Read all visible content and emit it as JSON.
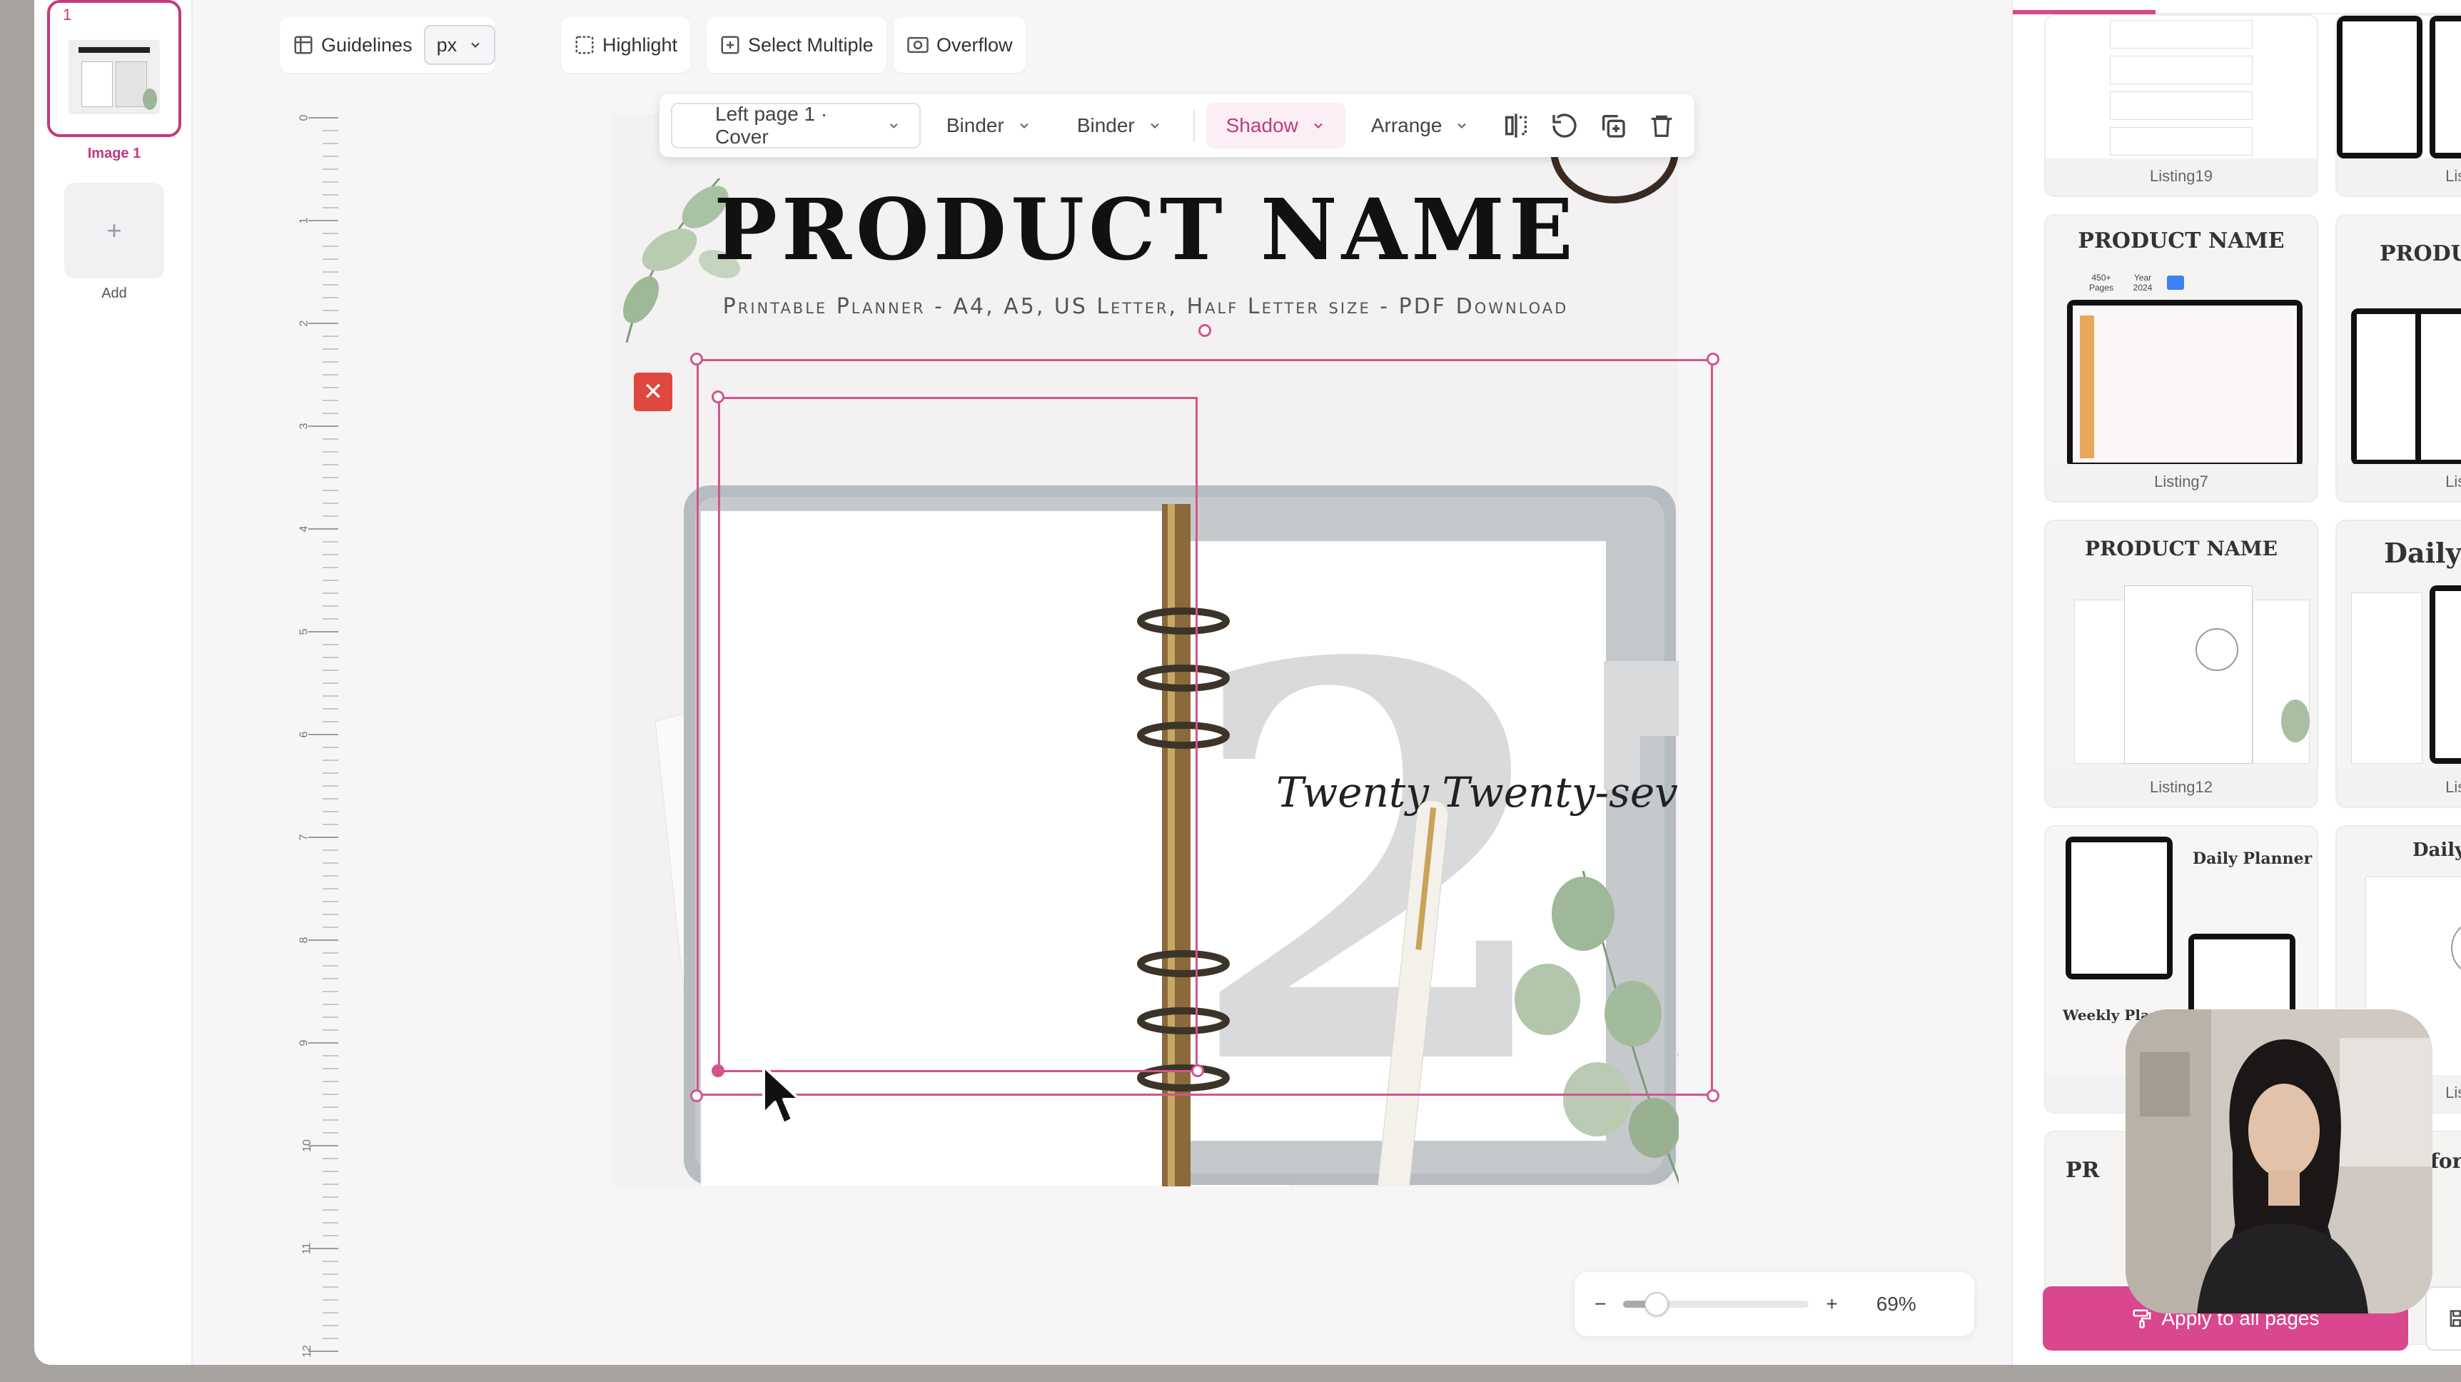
{
  "pages_panel": {
    "page_number": "1",
    "page_label": "Image 1",
    "add_label": "Add",
    "add_symbol": "+"
  },
  "top_toolbar": {
    "guidelines_label": "Guidelines",
    "unit_value": "px",
    "highlight_label": "Highlight",
    "select_multiple_label": "Select Multiple",
    "overflow_label": "Overflow"
  },
  "ruler": {
    "labels": [
      "0",
      "1",
      "2",
      "3",
      "4",
      "5",
      "6",
      "7",
      "8",
      "9",
      "10",
      "11",
      "12"
    ]
  },
  "context_toolbar": {
    "page_select": "Left page 1 · Cover",
    "binder_1": "Binder",
    "binder_2": "Binder",
    "shadow": "Shadow",
    "arrange": "Arrange",
    "icons": [
      "flip-icon",
      "rotate-icon",
      "duplicate-icon",
      "trash-icon"
    ]
  },
  "canvas": {
    "title": "PRODUCT NAME",
    "subtitle": "Printable Planner - A4, A5, US Letter, Half Letter size - PDF Download",
    "script_text": "Twenty Twenty-seven",
    "big_number": "27"
  },
  "zoom": {
    "minus": "−",
    "plus": "+",
    "value": "69%",
    "level": 0.18
  },
  "right_panel": {
    "templates": [
      {
        "label": "Listing19"
      },
      {
        "label": "Listing4"
      },
      {
        "label": "Listing7",
        "title": "PRODUCT NAME",
        "meta_pages": "450+ Pages",
        "meta_year": "Year 2024"
      },
      {
        "label": "Listing2",
        "title": "PRODUCT"
      },
      {
        "label": "Listing12",
        "title": "PRODUCT NAME"
      },
      {
        "label": "Listing2",
        "title": "Daily Pla"
      },
      {
        "label": "Listing1",
        "title": "Daily Planner",
        "title2": "Weekly Planner"
      },
      {
        "label": "Listing1",
        "title": "Daily Pla"
      },
      {
        "label": "",
        "title": "PR"
      },
      {
        "label": "",
        "title": "nal for"
      }
    ],
    "apply_button": "Apply to all pages",
    "save_button": "Sa"
  },
  "colors": {
    "accent": "#d9478e",
    "accent_dark": "#c2397d",
    "remove": "#e0483f"
  }
}
